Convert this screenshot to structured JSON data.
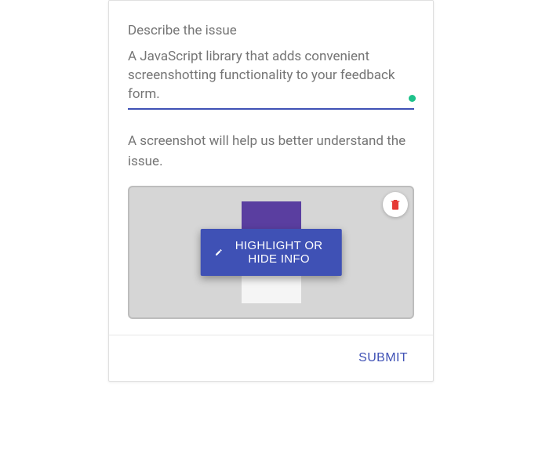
{
  "form": {
    "describe_label": "Describe the issue",
    "description_value": "A JavaScript library that adds convenient screenshotting functionality to your feedback form.",
    "screenshot_helper": "A screenshot will help us better understand the issue.",
    "highlight_button": "HIGHLIGHT OR HIDE INFO",
    "submit_button": "SUBMIT"
  },
  "icons": {
    "delete": "trash-icon",
    "edit": "pencil-icon"
  },
  "colors": {
    "primary": "#3f51b5",
    "danger": "#e53935",
    "accent_dot": "#1ec28b"
  }
}
